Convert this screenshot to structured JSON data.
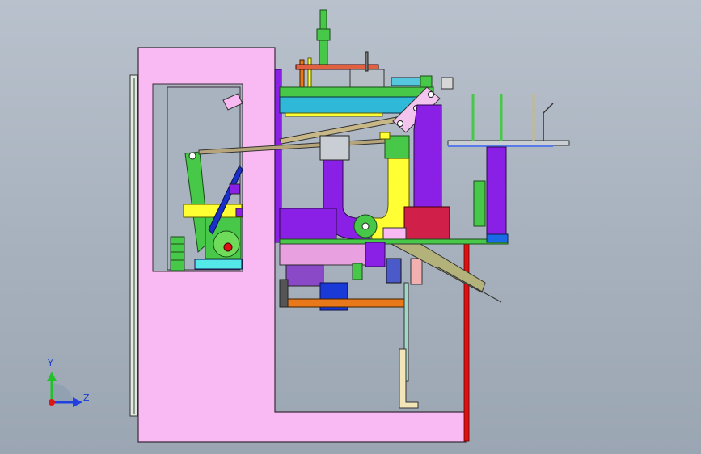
{
  "view": {
    "background_top": "#b8c1cc",
    "background_bottom": "#9ba6b3"
  },
  "triad": {
    "y_axis_label": "Y",
    "z_axis_label": "Z",
    "y_axis_color": "#22c02a",
    "z_axis_color": "#2240e0",
    "origin_color": "#e01515"
  },
  "colors": {
    "frame": "#f9b9f2",
    "purple": "#8a1fe6",
    "green": "#48c848",
    "yellow": "#ffff33",
    "blue": "#1a2ec8",
    "red": "#e01010",
    "orange": "#e8781a",
    "tan": "#f2e6b8"
  }
}
